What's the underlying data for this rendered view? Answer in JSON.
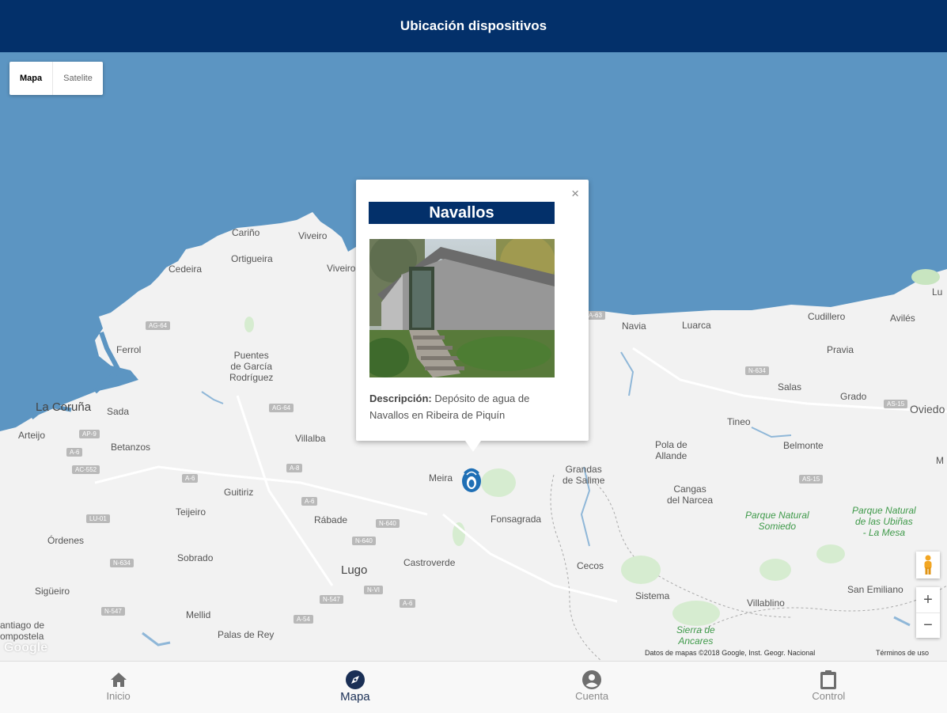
{
  "header": {
    "title": "Ubicación dispositivos"
  },
  "map_type": {
    "map_label": "Mapa",
    "satellite_label": "Satelite",
    "selected": "Mapa"
  },
  "popup": {
    "close_glyph": "×",
    "title": "Navallos",
    "description_label": "Descripción:",
    "description_text": "Depósito de agua de Navallos en Ribeira de Piquín"
  },
  "map_labels": {
    "carino": "Cariño",
    "viveiro1": "Viveiro",
    "ortigueira": "Ortigueira",
    "cedeira": "Cedeira",
    "viveiro2": "Viveiro",
    "ferrol": "Ferrol",
    "puentes": "Puentes\nde García\nRodríguez",
    "coruna": "La Coruña",
    "sada": "Sada",
    "arteijo": "Arteijo",
    "betanzos": "Betanzos",
    "villalba": "Villalba",
    "meira": "Meira",
    "guitiriz": "Guitiriz",
    "teijeiro": "Teijeiro",
    "rabade": "Rábade",
    "ordenes": "Órdenes",
    "sobrado": "Sobrado",
    "lugo": "Lugo",
    "castroverde": "Castroverde",
    "sigueiro": "Sigüeiro",
    "mellid": "Mellid",
    "palas": "Palas de Rey",
    "santiago": "antiago de\nompostela",
    "fonsagrada": "Fonsagrada",
    "grandas": "Grandas\nde Salime",
    "cecos": "Cecos",
    "navia": "Navia",
    "luarca": "Luarca",
    "cudillero": "Cudillero",
    "aviles": "Avilés",
    "pravia": "Pravia",
    "salas": "Salas",
    "grado": "Grado",
    "oviedo": "Oviedo",
    "tineo": "Tineo",
    "pola": "Pola de\nAllande",
    "belmonte": "Belmonte",
    "cangas": "Cangas\ndel Narcea",
    "somiedo": "Parque Natural\nSomiedo",
    "ubinas": "Parque Natural\nde las Ubiñas\n- La Mesa",
    "sistema": "Sistema",
    "villablino": "Villablino",
    "sanemiliano": "San Emiliano",
    "ancares": "Sierra de\nAncares",
    "lu_edge": "Lu",
    "m_edge": "M"
  },
  "road_shields": [
    "AG-64",
    "AG-64",
    "AP-9",
    "A-6",
    "AC-552",
    "A-6",
    "A-8",
    "A-6",
    "N-640",
    "LU-01",
    "N-640",
    "N-634",
    "N-634",
    "AS-15",
    "N-547",
    "A-54",
    "N-VI",
    "A-6",
    "N-547",
    "A-63",
    "AS-15"
  ],
  "google_logo": "Google",
  "attribution": {
    "data": "Datos de mapas ©2018 Google, Inst. Geogr. Nacional",
    "terms": "Términos de uso"
  },
  "controls": {
    "zoom_in": "+",
    "zoom_out": "−"
  },
  "bottom_nav": [
    {
      "label": "Inicio",
      "icon": "home-icon"
    },
    {
      "label": "Mapa",
      "icon": "compass-icon",
      "active": true
    },
    {
      "label": "Cuenta",
      "icon": "account-icon"
    },
    {
      "label": "Control",
      "icon": "clipboard-icon"
    }
  ],
  "colors": {
    "header": "#03306a",
    "water": "#5c95c2",
    "land": "#f2f2f2",
    "park": "#3f9a4a",
    "marker": "#1f6fb5"
  }
}
